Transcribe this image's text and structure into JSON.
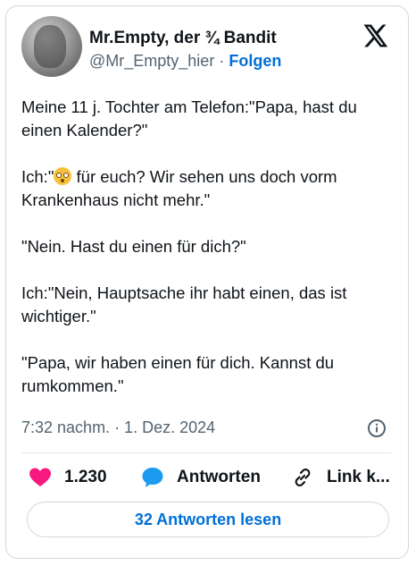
{
  "author": {
    "name": "Mr.Empty, der ¾ Bandit",
    "handle": "@Mr_Empty_hier",
    "separator": "·",
    "follow_label": "Folgen"
  },
  "tweet": {
    "p1": "Meine 11 j. Tochter am Telefon:\"Papa, hast du einen Kalender?\"",
    "p2_prefix": "Ich:\"",
    "p2_emoji": "flushed-face-emoji",
    "p2_suffix": " für euch? Wir sehen uns doch vorm Krankenhaus nicht mehr.\"",
    "p3": "\"Nein. Hast du einen für dich?\"",
    "p4": "Ich:\"Nein, Hauptsache ihr habt einen, das ist wichtiger.\"",
    "p5": "\"Papa, wir haben einen für dich. Kannst du rumkommen.\""
  },
  "timestamp": "7:32 nachm. · 1. Dez. 2024",
  "actions": {
    "like_count": "1.230",
    "reply_label": "Antworten",
    "link_label": "Link k..."
  },
  "read_replies_label": "32 Antworten lesen",
  "colors": {
    "link_blue": "#006fd6",
    "heart_red": "#f91880",
    "reply_blue": "#1d9bf0",
    "muted_gray": "#536471"
  }
}
